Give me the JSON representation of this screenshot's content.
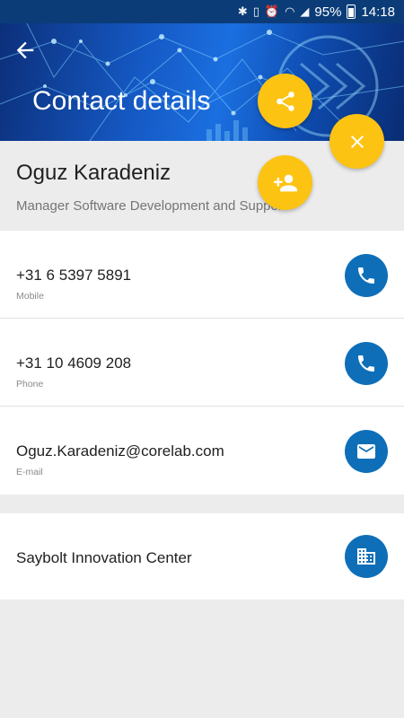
{
  "statusbar": {
    "battery_text": "95%",
    "time": "14:18",
    "icons": [
      "bluetooth-icon",
      "vibrate-icon",
      "alarm-icon",
      "wifi-icon",
      "signal-icon",
      "battery-icon"
    ]
  },
  "header": {
    "title": "Contact details"
  },
  "contact": {
    "name": "Oguz Karadeniz",
    "role": "Manager Software Development and Support"
  },
  "details": [
    {
      "value": "+31 6 5397 5891",
      "label": "Mobile",
      "icon": "phone-icon"
    },
    {
      "value": "+31 10 4609 208",
      "label": "Phone",
      "icon": "phone-icon"
    },
    {
      "value": "Oguz.Karadeniz@corelab.com",
      "label": "E-mail",
      "icon": "mail-icon"
    }
  ],
  "company": {
    "value": "Saybolt Innovation Center",
    "icon": "building-icon"
  },
  "fabs": {
    "share": "share-icon",
    "close": "close-icon",
    "add_contact": "add-contact-icon"
  },
  "colors": {
    "statusbar": "#0b3c78",
    "header": "#1559c4",
    "fab": "#fdc313",
    "action_button": "#0e6fb8"
  }
}
